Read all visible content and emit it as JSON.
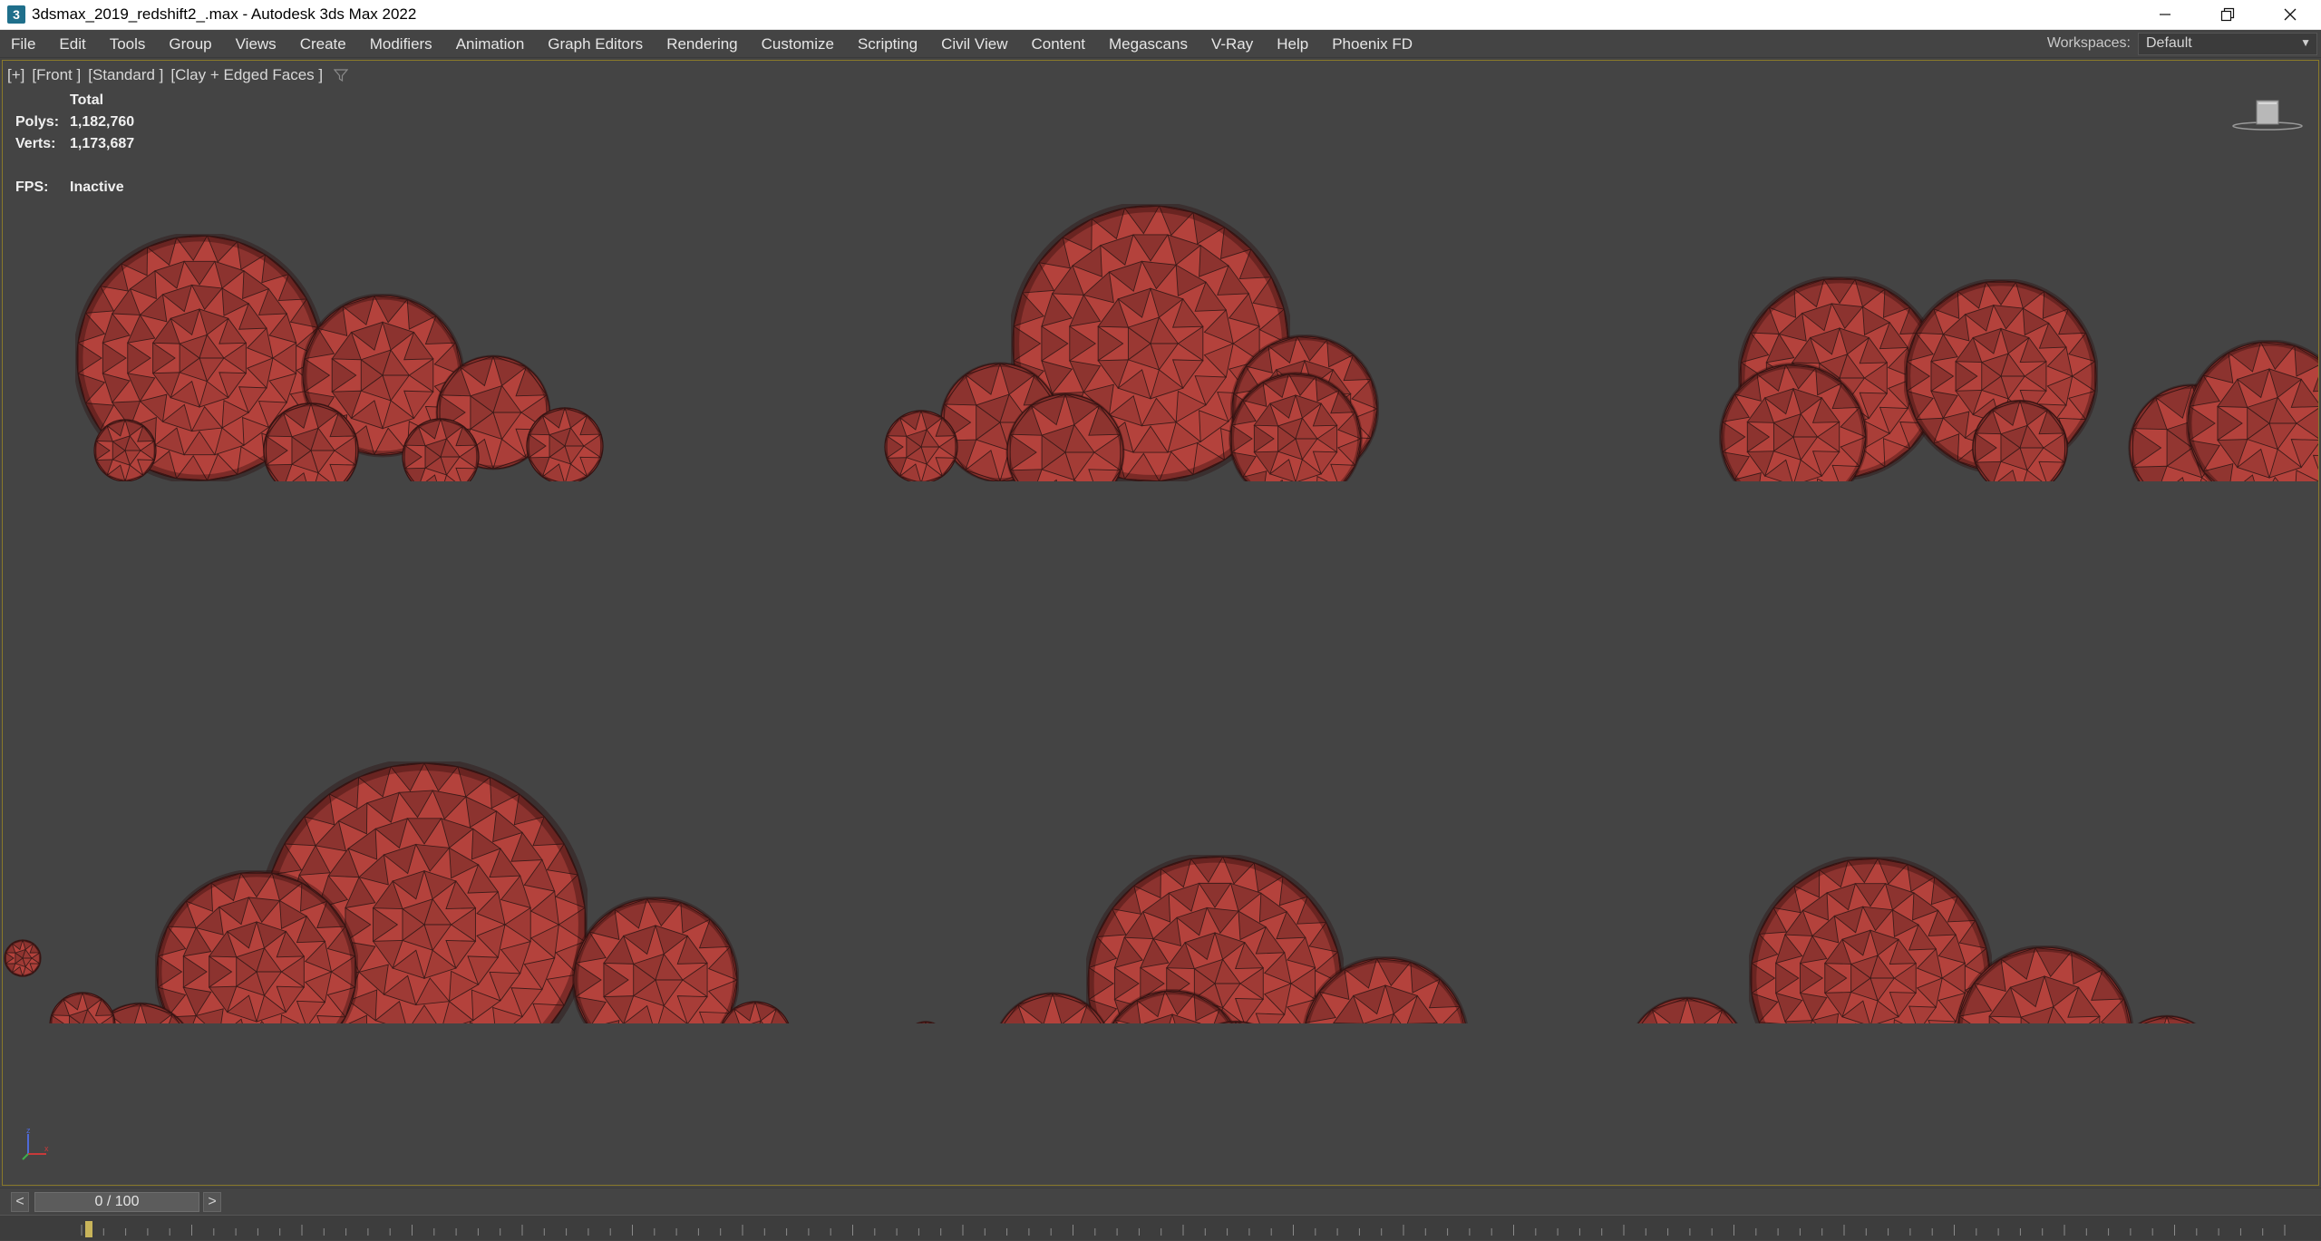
{
  "window": {
    "title": "3dsmax_2019_redshift2_.max - Autodesk 3ds Max 2022",
    "app_icon": "3"
  },
  "menu": {
    "items": [
      "File",
      "Edit",
      "Tools",
      "Group",
      "Views",
      "Create",
      "Modifiers",
      "Animation",
      "Graph Editors",
      "Rendering",
      "Customize",
      "Scripting",
      "Civil View",
      "Content",
      "Megascans",
      "V-Ray",
      "Help",
      "Phoenix FD"
    ],
    "workspaces_label": "Workspaces:",
    "workspaces_value": "Default"
  },
  "viewport": {
    "label_plus": "[+]",
    "label_view": "[Front ]",
    "label_mode": "[Standard ]",
    "label_shading": "[Clay + Edged Faces ]",
    "stats": {
      "header": "Total",
      "polys_label": "Polys:",
      "polys_value": "1,182,760",
      "verts_label": "Verts:",
      "verts_value": "1,173,687",
      "fps_label": "FPS:",
      "fps_value": "Inactive"
    },
    "object_color": "#b4423c",
    "border_color": "#8a7a2a"
  },
  "timeline": {
    "prev": "<",
    "next": ">",
    "frame_display": "0 / 100"
  }
}
